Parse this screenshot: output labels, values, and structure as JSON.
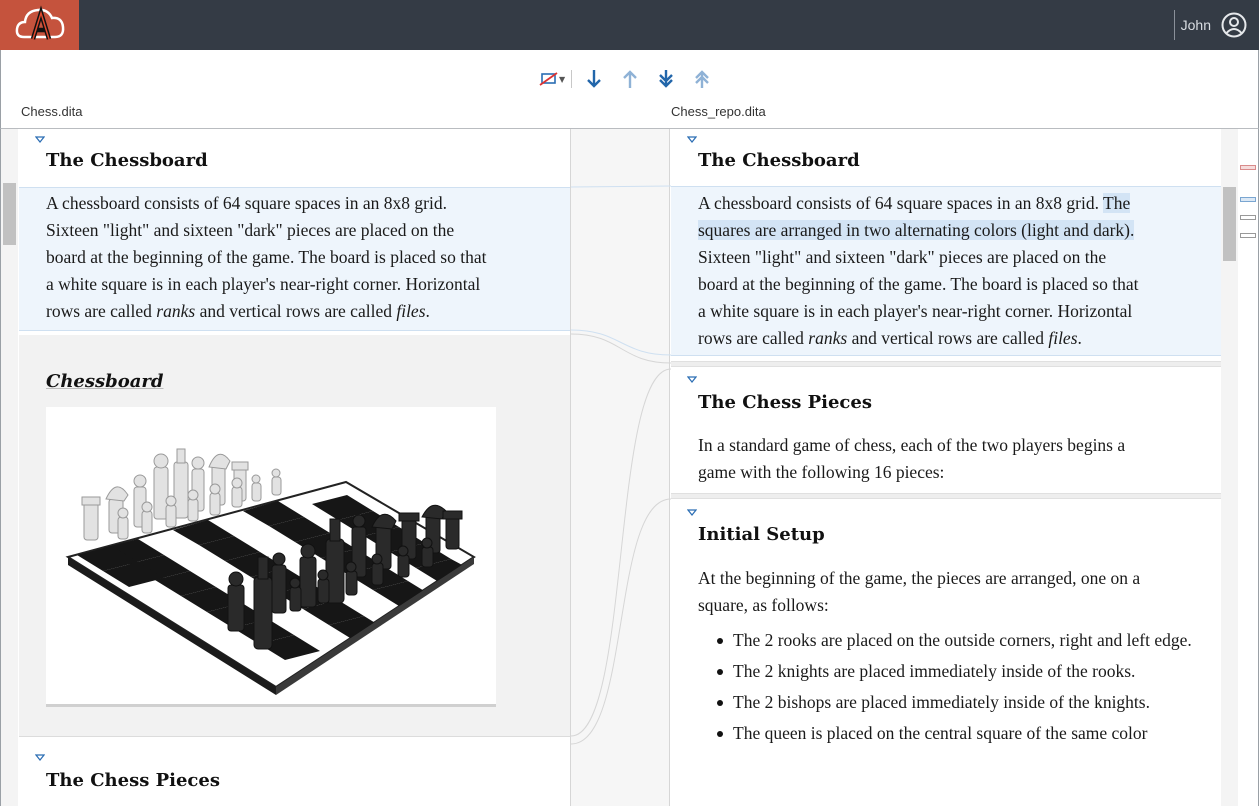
{
  "header": {
    "user_name": "John",
    "logo_icon": "app-logo-icon",
    "avatar_icon": "user-circle-icon"
  },
  "toolbar": {
    "tools": [
      "ignore-whitespace-icon",
      "next-change-icon",
      "previous-change-icon",
      "last-change-icon",
      "first-change-icon"
    ]
  },
  "files": {
    "left": "Chess.dita",
    "right": "Chess_repo.dita"
  },
  "left": {
    "heading1": "The Chessboard",
    "para_lines": [
      "A chessboard consists of 64 square spaces in an 8x8 grid.",
      "Sixteen \"light\" and sixteen \"dark\" pieces are placed on the",
      "board at the beginning of the game. The board is placed so that",
      "a white square is in each player's near-right corner. Horizontal"
    ],
    "para_last_a": "rows are called ",
    "para_last_ranks": "ranks",
    "para_last_b": " and vertical rows are called ",
    "para_last_files": "files",
    "para_last_c": ".",
    "figure_title": "Chessboard",
    "heading2": "The Chess Pieces"
  },
  "right": {
    "heading1": "The Chessboard",
    "para_line1_a": "A chessboard consists of 64 square spaces in an 8x8 grid. ",
    "para_line1_hl": "The",
    "para_line2_hl": "squares are arranged in two alternating colors (light and dark).",
    "para_lines": [
      "Sixteen \"light\" and sixteen \"dark\" pieces are placed on the",
      "board at the beginning of the game. The board is placed so that",
      "a white square is in each player's near-right corner. Horizontal"
    ],
    "para_last_a": "rows are called ",
    "para_last_ranks": "ranks",
    "para_last_b": " and vertical rows are called ",
    "para_last_files": "files",
    "para_last_c": ".",
    "heading2": "The Chess Pieces",
    "pieces_lines": [
      "In a standard game of chess, each of the two players begins a",
      "game with the following 16 pieces:"
    ],
    "heading3": "Initial Setup",
    "setup_lines": [
      "At the beginning of the game, the pieces are arranged, one on a",
      "square, as follows:"
    ],
    "setup_items": [
      "The 2 rooks are placed on the outside corners, right and left edge.",
      "The 2 knights are placed immediately inside of the rooks.",
      "The 2 bishops are placed immediately inside of the knights.",
      "The queen is placed on the central square of the same color"
    ]
  },
  "colors": {
    "topbar": "#343b45",
    "logo_bg": "#c5533d",
    "accent": "#1f6fb5",
    "change_bg": "#eef5fc",
    "highlight": "#d3e4f5"
  }
}
